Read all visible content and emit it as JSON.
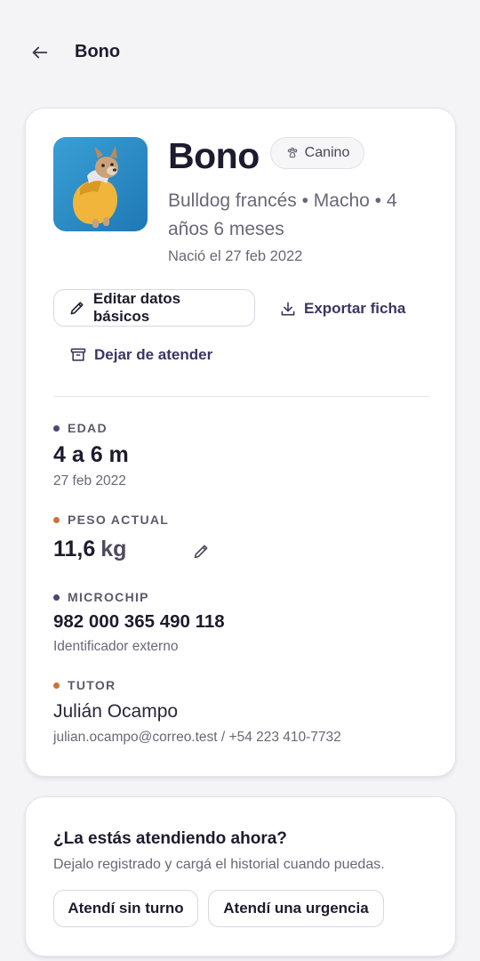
{
  "header": {
    "title": "Bono",
    "back_icon": "arrow-left-icon"
  },
  "pet": {
    "name": "Bono",
    "species_chip": "Canino",
    "species_icon": "paw-icon",
    "description": "Bulldog francés • Macho • 4 años 6 meses",
    "birth_text": "Nació el 27 feb 2022"
  },
  "actions": {
    "edit_label": "Editar datos básicos",
    "edit_icon": "pencil-icon",
    "export_label": "Exportar ficha",
    "export_icon": "download-icon",
    "stop_label": "Dejar de atender",
    "stop_icon": "archive-icon"
  },
  "fields": {
    "age": {
      "label": "EDAD",
      "value": "4 a 6 m",
      "sub": "27 feb 2022"
    },
    "weight": {
      "label": "PESO ACTUAL",
      "value": "11,6",
      "unit": "kg",
      "edit_icon": "pencil-icon"
    },
    "microchip": {
      "label": "MICROCHIP",
      "value": "982 000 365 490 118",
      "sub": "Identificador externo"
    },
    "tutor": {
      "label": "TUTOR",
      "value": "Julián Ocampo",
      "sub": "julian.ocampo@correo.test / +54 223 410-7732"
    }
  },
  "attend": {
    "title": "¿La estás atendiendo ahora?",
    "subtitle": "Dejalo registrado y cargá el historial cuando puedas.",
    "no_turn_label": "Atendí sin turno",
    "urgent_label": "Atendí una urgencia"
  },
  "colors": {
    "accent_purple": "#4b4577",
    "accent_orange": "#c9733a",
    "avatar_bg": "#2f8fc9",
    "dog_coat": "#f0b53a"
  }
}
